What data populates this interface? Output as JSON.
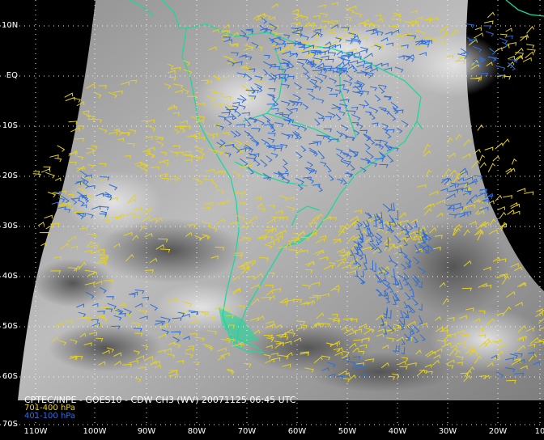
{
  "title": "CPTEC/INPE - GOES10 - CDW CH3 (WV) 20071125 06:45 UTC",
  "legend": [
    {
      "label": "701-400 hPa",
      "color": "#e6d21e"
    },
    {
      "label": "401-100 hPa",
      "color": "#2f6ed8"
    }
  ],
  "colors": {
    "background": "#000000",
    "imagery_light": "#b4b4b4",
    "imagery_dark": "#5a5a5a",
    "coastline": "#1fd79a",
    "grid": "#ffffff"
  },
  "grid": {
    "lat_labels": [
      "10N",
      "EQ",
      "10S",
      "20S",
      "30S",
      "40S",
      "50S",
      "60S",
      "70S"
    ],
    "lon_labels": [
      "110W",
      "100W",
      "90W",
      "80W",
      "70W",
      "60W",
      "50W",
      "40W",
      "30W",
      "20W",
      "10"
    ],
    "style": "dotted"
  },
  "features": {
    "imagery": "water vapour channel",
    "vector_type": "wind barbs",
    "cloud_track_layers": 2
  }
}
